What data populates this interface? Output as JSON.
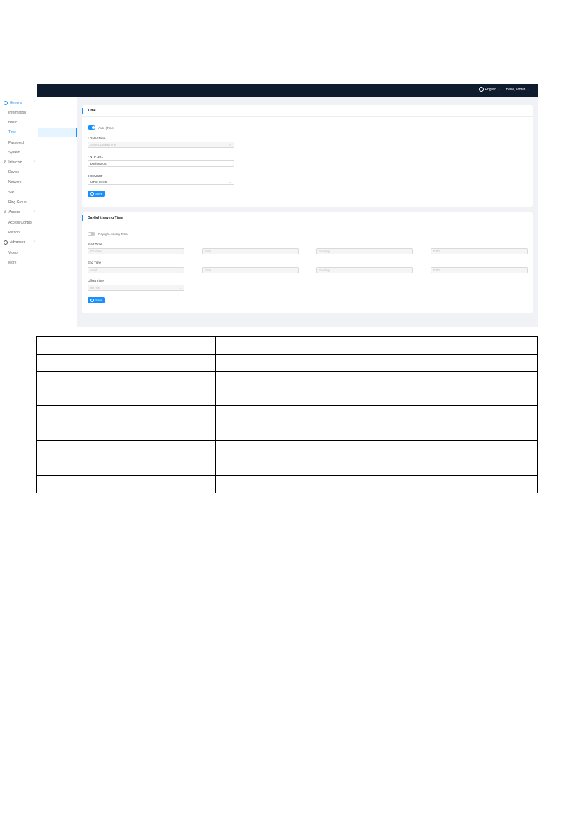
{
  "topbar": {
    "language": "English",
    "language_chevron": "⌄",
    "user": "Hello, admin",
    "user_chevron": "⌄"
  },
  "sidebar": {
    "groups": [
      {
        "label": "General",
        "items": [
          "Information",
          "Basic",
          "Time",
          "Password",
          "System"
        ]
      },
      {
        "label": "Intercom",
        "items": [
          "Device",
          "Network",
          "SIP",
          "Ring Group"
        ]
      },
      {
        "label": "Access",
        "items": [
          "Access Control",
          "Person"
        ]
      },
      {
        "label": "Advanced",
        "items": [
          "Video",
          "More"
        ]
      }
    ],
    "active_item": "Time"
  },
  "time_card": {
    "title": "Time",
    "auto_time_label": "Auto (Time)",
    "datetime_label": "* Date&Time",
    "datetime_placeholder": "Select Date&Time",
    "ntp_label": "* NTP URL",
    "ntp_value": "pool.ntp.org",
    "timezone_label": "Time Zone",
    "timezone_value": "UTC+08:00",
    "save_label": "Save"
  },
  "dst_card": {
    "title": "Daylight-saving Time",
    "toggle_label": "Daylight-saving Time",
    "start_label": "Start Time",
    "start_values": [
      "October",
      "First",
      "Sunday",
      "0:00"
    ],
    "end_label": "End Time",
    "end_values": [
      "April",
      "First",
      "Sunday",
      "0:00"
    ],
    "offset_label": "Offset Time",
    "offset_value": "60 min",
    "save_label": "Save"
  },
  "table": {
    "rows": [
      [
        "",
        ""
      ],
      [
        "",
        ""
      ],
      [
        "",
        ""
      ],
      [
        "",
        ""
      ],
      [
        "",
        ""
      ],
      [
        "",
        ""
      ],
      [
        "",
        ""
      ],
      [
        "",
        ""
      ]
    ]
  }
}
